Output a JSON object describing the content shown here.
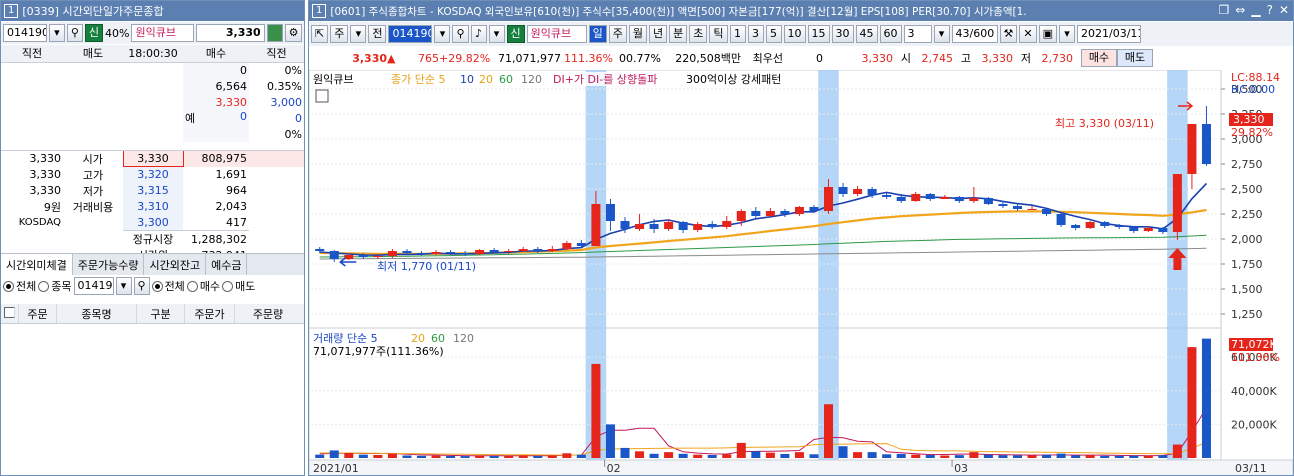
{
  "left": {
    "title": "[0339] 시간외단일가주문종합",
    "window_number": "1",
    "code": "014190",
    "sin": "신",
    "margin": "40%",
    "stock_name": "원익큐브",
    "price": "3,330",
    "ob_headers": [
      "직전",
      "매도",
      "18:00:30",
      "매수",
      "직전"
    ],
    "bid_rows": [
      {
        "qty": "0",
        "pct": "0%"
      },
      {
        "qty": "6,564",
        "pct": "0.35%"
      },
      {
        "qty": "3,330",
        "pct": "3,000"
      }
    ],
    "ye_label": "예",
    "ye_value": "0",
    "ye_right": "0",
    "ye_pct": "0%",
    "info_rows": [
      {
        "left": "3,330",
        "label": "시가",
        "price": "3,330",
        "qty": "808,975"
      },
      {
        "left": "3,330",
        "label": "고가",
        "price": "3,320",
        "qty": "1,691"
      },
      {
        "left": "3,330",
        "label": "저가",
        "price": "3,315",
        "qty": "964"
      },
      {
        "left": "9원",
        "label": "거래비용",
        "price": "3,310",
        "qty": "2,043"
      },
      {
        "left": "KOSDAQ",
        "label": "",
        "price": "3,300",
        "qty": "417"
      }
    ],
    "regular_label": "정규시장",
    "regular_value": "1,288,302",
    "after_label": "시간외",
    "after_value": "732,941",
    "tabs": [
      "시간외미체결",
      "주문가능수량",
      "시간외잔고",
      "예수금"
    ],
    "filter_all": "전체",
    "filter_stock": "종목",
    "filter_code": "014190",
    "filter_all2": "전체",
    "filter_buy": "매수",
    "filter_sell": "매도",
    "order_headers": [
      "주문",
      "종목명",
      "구분",
      "주문가",
      "주문량"
    ]
  },
  "right": {
    "title": "[0601] 주식종합차트 - KOSDAQ 외국인보유[610(천)] 주식수[35,400(천)] 액면[500] 자본금[177(억)] 결산[12월] EPS[108] PER[30.70] 시가총액[1.",
    "window_number": "1",
    "toolbar": {
      "ju": "주",
      "jeon": "전",
      "code": "014190",
      "sin": "신",
      "name": "원익큐브",
      "periods": [
        "일",
        "주",
        "월",
        "년",
        "분",
        "초",
        "틱"
      ],
      "minutes": [
        "1",
        "3",
        "5",
        "10",
        "15",
        "30",
        "45",
        "60"
      ],
      "unit": "3",
      "count": "43/600",
      "date": "2021/03/11"
    },
    "quote": {
      "price": "3,330",
      "change": "765",
      "change_pct": "+29.82%",
      "volume": "71,071,977",
      "vol_ratio": "111.36%",
      "turnover": "00.77%",
      "amount": "220,508백만",
      "best_label": "최우선",
      "best_value": "0",
      "ref_price": "3,330",
      "open_label": "시",
      "open": "2,745",
      "high_label": "고",
      "high": "3,330",
      "low_label": "저",
      "low": "2,730",
      "buy_btn": "매수",
      "sell_btn": "매도"
    },
    "legend": {
      "name": "원익큐브",
      "ma_label": "종가 단순 5",
      "ma10": "10",
      "ma20": "20",
      "ma60": "60",
      "ma120": "120",
      "signal": "DI+가 DI-를 상향돌파",
      "pattern": "300억이상 강세패턴"
    },
    "vol_legend": {
      "label": "거래량 단순 5",
      "ma20": "20",
      "ma60": "60",
      "ma120": "120",
      "value": "71,071,977주(111.36%)"
    },
    "lc": "LC:88.14",
    "hc": "HC:0.00",
    "last_price_tag": "3,330",
    "last_pct_tag": "29.82%",
    "vol_tag": "71,072K",
    "vol_pct_tag": "111.36%",
    "high_annot": "최고 3,330 (03/11)",
    "low_annot": "최저 1,770 (01/11)"
  },
  "chart_data": {
    "type": "candlestick",
    "price_ticks": [
      "3,500",
      "3,250",
      "3,000",
      "2,750",
      "2,500",
      "2,250",
      "2,000",
      "1,750",
      "1,500",
      "1,250"
    ],
    "volume_ticks": [
      "60,000K",
      "40,000K",
      "20,000K"
    ],
    "x_labels": [
      "2021/01",
      "02",
      "03",
      "03/11"
    ],
    "ylim": [
      1150,
      3550
    ],
    "vol_max": 75000,
    "highlights": [
      19,
      35,
      59
    ],
    "candles": [
      [
        1900,
        1880,
        1920,
        1860,
        2000
      ],
      [
        1880,
        1800,
        1890,
        1770,
        4500
      ],
      [
        1800,
        1840,
        1860,
        1790,
        3000
      ],
      [
        1840,
        1820,
        1860,
        1800,
        2000
      ],
      [
        1820,
        1830,
        1850,
        1800,
        1800
      ],
      [
        1830,
        1880,
        1900,
        1810,
        2600
      ],
      [
        1880,
        1860,
        1900,
        1840,
        1500
      ],
      [
        1860,
        1850,
        1880,
        1830,
        1300
      ],
      [
        1850,
        1870,
        1890,
        1840,
        1400
      ],
      [
        1870,
        1860,
        1890,
        1840,
        1200
      ],
      [
        1860,
        1850,
        1880,
        1830,
        1100
      ],
      [
        1850,
        1890,
        1900,
        1840,
        1500
      ],
      [
        1890,
        1870,
        1910,
        1860,
        1200
      ],
      [
        1870,
        1880,
        1900,
        1850,
        1300
      ],
      [
        1880,
        1900,
        1920,
        1870,
        1600
      ],
      [
        1900,
        1880,
        1920,
        1860,
        1200
      ],
      [
        1880,
        1900,
        1930,
        1870,
        1600
      ],
      [
        1900,
        1960,
        1980,
        1890,
        2800
      ],
      [
        1960,
        1930,
        1990,
        1920,
        2000
      ],
      [
        1930,
        2350,
        2480,
        1930,
        56000
      ],
      [
        2350,
        2180,
        2400,
        2080,
        20000
      ],
      [
        2180,
        2100,
        2220,
        2060,
        6000
      ],
      [
        2100,
        2150,
        2250,
        2080,
        4000
      ],
      [
        2150,
        2100,
        2200,
        2060,
        2500
      ],
      [
        2100,
        2170,
        2200,
        2080,
        3500
      ],
      [
        2170,
        2090,
        2180,
        2060,
        2500
      ],
      [
        2090,
        2150,
        2170,
        2070,
        2000
      ],
      [
        2150,
        2120,
        2180,
        2100,
        1800
      ],
      [
        2120,
        2180,
        2230,
        2100,
        2200
      ],
      [
        2180,
        2280,
        2300,
        2130,
        9000
      ],
      [
        2280,
        2230,
        2320,
        2200,
        4000
      ],
      [
        2230,
        2280,
        2310,
        2220,
        3200
      ],
      [
        2280,
        2250,
        2300,
        2220,
        2400
      ],
      [
        2250,
        2320,
        2330,
        2230,
        3500
      ],
      [
        2320,
        2280,
        2340,
        2260,
        2200
      ],
      [
        2280,
        2520,
        2600,
        2250,
        32000
      ],
      [
        2520,
        2450,
        2560,
        2420,
        7000
      ],
      [
        2450,
        2500,
        2530,
        2430,
        3500
      ],
      [
        2500,
        2440,
        2520,
        2410,
        3500
      ],
      [
        2440,
        2420,
        2460,
        2400,
        2200
      ],
      [
        2420,
        2380,
        2450,
        2360,
        2400
      ],
      [
        2380,
        2450,
        2470,
        2370,
        2000
      ],
      [
        2450,
        2400,
        2460,
        2380,
        1800
      ],
      [
        2400,
        2420,
        2440,
        2400,
        1500
      ],
      [
        2420,
        2380,
        2430,
        2360,
        1700
      ],
      [
        2380,
        2410,
        2520,
        2360,
        3500
      ],
      [
        2410,
        2350,
        2420,
        2340,
        2000
      ],
      [
        2350,
        2330,
        2380,
        2310,
        1700
      ],
      [
        2330,
        2300,
        2360,
        2280,
        1600
      ],
      [
        2300,
        2300,
        2330,
        2290,
        1500
      ],
      [
        2300,
        2250,
        2310,
        2230,
        2000
      ],
      [
        2250,
        2140,
        2260,
        2120,
        2600
      ],
      [
        2140,
        2110,
        2150,
        2090,
        1600
      ],
      [
        2110,
        2170,
        2180,
        2100,
        1700
      ],
      [
        2170,
        2130,
        2180,
        2110,
        1300
      ],
      [
        2130,
        2120,
        2150,
        2100,
        1300
      ],
      [
        2120,
        2080,
        2130,
        2060,
        1400
      ],
      [
        2080,
        2110,
        2130,
        2070,
        1200
      ],
      [
        2110,
        2070,
        2120,
        2050,
        1700
      ],
      [
        2070,
        2650,
        2650,
        1990,
        8000
      ],
      [
        2650,
        3150,
        3150,
        2500,
        66000
      ],
      [
        3150,
        2750,
        3330,
        2730,
        71072
      ]
    ],
    "ma5": [
      1870,
      1860,
      1850,
      1840,
      1838,
      1846,
      1846,
      1848,
      1858,
      1852,
      1852,
      1856,
      1862,
      1866,
      1880,
      1880,
      1886,
      1904,
      1914,
      1996,
      2056,
      2096,
      2142,
      2176,
      2190,
      2158,
      2136,
      2124,
      2138,
      2164,
      2202,
      2222,
      2244,
      2272,
      2272,
      2330,
      2360,
      2398,
      2438,
      2466,
      2438,
      2422,
      2418,
      2414,
      2406,
      2412,
      2402,
      2376,
      2354,
      2338,
      2306,
      2264,
      2226,
      2194,
      2154,
      2134,
      2122,
      2122,
      2102,
      2206,
      2402,
      2556
    ],
    "ma20": [
      1860,
      1858,
      1856,
      1854,
      1852,
      1852,
      1852,
      1852,
      1852,
      1854,
      1856,
      1858,
      1862,
      1866,
      1870,
      1874,
      1878,
      1884,
      1890,
      1916,
      1930,
      1942,
      1954,
      1966,
      1980,
      1992,
      2004,
      2016,
      2028,
      2046,
      2062,
      2080,
      2096,
      2112,
      2128,
      2150,
      2168,
      2186,
      2204,
      2216,
      2228,
      2236,
      2244,
      2252,
      2260,
      2266,
      2270,
      2274,
      2276,
      2276,
      2276,
      2272,
      2268,
      2262,
      2256,
      2250,
      2244,
      2240,
      2232,
      2246,
      2266,
      2290
    ],
    "ma60": [
      1820,
      1821,
      1822,
      1823,
      1824,
      1826,
      1828,
      1830,
      1832,
      1834,
      1837,
      1840,
      1843,
      1846,
      1849,
      1852,
      1856,
      1860,
      1864,
      1870,
      1875,
      1880,
      1885,
      1890,
      1895,
      1900,
      1905,
      1910,
      1915,
      1920,
      1925,
      1930,
      1935,
      1940,
      1945,
      1952,
      1958,
      1964,
      1970,
      1976,
      1980,
      1984,
      1988,
      1992,
      1996,
      1998,
      2000,
      2002,
      2004,
      2006,
      2008,
      2010,
      2011,
      2012,
      2013,
      2014,
      2015,
      2016,
      2017,
      2022,
      2030,
      2038
    ],
    "ma120": [
      1800,
      1801,
      1802,
      1803,
      1804,
      1805,
      1806,
      1807,
      1808,
      1809,
      1810,
      1811,
      1812,
      1813,
      1814,
      1815,
      1816,
      1817,
      1818,
      1820,
      1822,
      1824,
      1826,
      1828,
      1830,
      1832,
      1834,
      1836,
      1838,
      1840,
      1842,
      1844,
      1846,
      1848,
      1850,
      1852,
      1854,
      1856,
      1858,
      1860,
      1862,
      1864,
      1866,
      1868,
      1870,
      1872,
      1874,
      1876,
      1878,
      1880,
      1882,
      1884,
      1886,
      1888,
      1890,
      1892,
      1894,
      1896,
      1898,
      1901,
      1904,
      1907
    ],
    "vol_ma5": [
      2500,
      2700,
      2900,
      2700,
      2660,
      2740,
      2180,
      1840,
      1720,
      1560,
      1300,
      1300,
      1300,
      1300,
      1360,
      1360,
      1380,
      1700,
      1760,
      12640,
      16560,
      16560,
      17760,
      17700,
      7200,
      3700,
      2900,
      2460,
      2400,
      3700,
      3920,
      4040,
      4160,
      4460,
      11000,
      12400,
      12000,
      10000,
      9600,
      3700,
      3120,
      2500,
      2000,
      2100,
      2300,
      2400,
      2100,
      1880,
      1820,
      1700,
      1760,
      1840,
      1720,
      1740,
      1700,
      1560,
      1440,
      1380,
      1460,
      2840,
      15660,
      30000
    ],
    "vol_ma20": [
      3000,
      3000,
      3000,
      2900,
      2800,
      2700,
      2600,
      2500,
      2400,
      2300,
      2200,
      2100,
      2000,
      1900,
      1900,
      1850,
      1800,
      1800,
      1800,
      4500,
      5300,
      5500,
      5600,
      5700,
      5800,
      5900,
      5900,
      5900,
      6000,
      6300,
      6400,
      6500,
      6600,
      6700,
      8000,
      8200,
      8300,
      8400,
      8500,
      8600,
      5200,
      4500,
      4300,
      4200,
      4200,
      4000,
      3800,
      3700,
      3600,
      3500,
      3400,
      3300,
      3200,
      3100,
      2900,
      2800,
      2700,
      2600,
      2500,
      2700,
      5800,
      9400
    ]
  }
}
